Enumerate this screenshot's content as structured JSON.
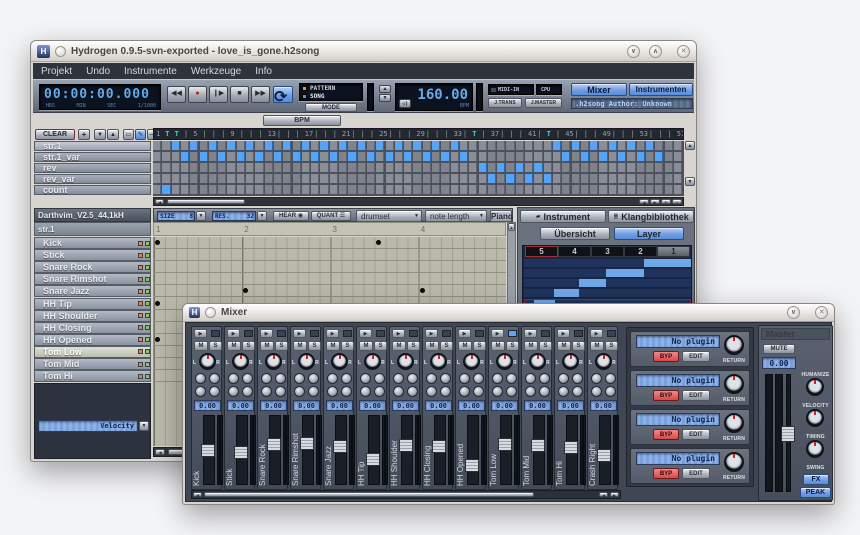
{
  "main_window": {
    "title": "Hydrogen 0.9.5-svn-exported - love_is_gone.h2song",
    "menu": [
      "Projekt",
      "Undo",
      "Instrumente",
      "Werkzeuge",
      "Info"
    ],
    "transport": {
      "time": "00:00:00.000",
      "time_labels": [
        "HRS",
        "MIN",
        "SEC",
        "1/1000"
      ],
      "mode_pattern": "PATTERN",
      "mode_song": "SONG",
      "mode_label": "MODE",
      "bpm_value": "160.00",
      "bpm_label": "BPM",
      "midi_in": "MIDI-IN",
      "cpu": "CPU",
      "jtrans": "J.TRANS",
      "jmaster": "J.MASTER",
      "mixer_btn": "Mixer",
      "rack_btn": "Instrumenten Rack",
      "song_lcd": ".h2song      Author: Unknown"
    },
    "bpm_tab": "BPM",
    "song_editor": {
      "clear_btn": "CLEAR",
      "add_btn": "+",
      "cols": 57,
      "ruler_number_step": 4,
      "t_cells": [
        1,
        2,
        34,
        42
      ],
      "patterns": [
        {
          "name": "str.1",
          "selected": true,
          "cells": [
            2,
            4,
            6,
            8,
            10,
            12,
            14,
            16,
            18,
            20,
            22,
            24,
            26,
            28,
            30,
            32,
            43,
            45,
            47,
            49,
            51,
            53
          ]
        },
        {
          "name": "str.1_var",
          "selected": false,
          "cells": [
            3,
            5,
            7,
            9,
            11,
            13,
            15,
            17,
            19,
            21,
            23,
            25,
            27,
            29,
            31,
            33,
            44,
            46,
            48,
            50,
            52,
            54
          ]
        },
        {
          "name": "rev",
          "selected": false,
          "cells": [
            35,
            37,
            39,
            41
          ]
        },
        {
          "name": "rev_var",
          "selected": false,
          "cells": [
            36,
            38,
            40,
            42
          ]
        },
        {
          "name": "count",
          "selected": false,
          "cells": [
            1
          ]
        }
      ]
    },
    "pattern_editor": {
      "drumkit": "Darthvim_V2.5_44,1kH",
      "pattern_name": "str.1",
      "size_label": "SIZE",
      "size_value": "8",
      "res_label": "RES.",
      "res_value": "32",
      "hear_label": "HEAR",
      "quant_label": "QUANT",
      "drumset_dropdown": "drumset",
      "notelength_dropdown": "note length",
      "piano_btn": "Piano",
      "beats": [
        "1",
        "2",
        "3",
        "4"
      ],
      "velocity_label": "Velocity",
      "instruments": [
        {
          "name": "Kick",
          "selected": false,
          "notes": [
            1,
            3.5
          ]
        },
        {
          "name": "Stick",
          "selected": false,
          "notes": []
        },
        {
          "name": "Snare Rock",
          "selected": false,
          "notes": []
        },
        {
          "name": "Snare Rimshot",
          "selected": false,
          "notes": []
        },
        {
          "name": "Snare Jazz",
          "selected": false,
          "notes": [
            2,
            4
          ]
        },
        {
          "name": "HH Tip",
          "selected": false,
          "notes": [
            1
          ]
        },
        {
          "name": "HH Shoulder",
          "selected": false,
          "notes": []
        },
        {
          "name": "HH Closing",
          "selected": false,
          "notes": []
        },
        {
          "name": "HH Opened",
          "selected": false,
          "notes": [
            1
          ]
        },
        {
          "name": "Tom Low",
          "selected": true,
          "notes": []
        },
        {
          "name": "Tom Mid",
          "selected": false,
          "notes": []
        },
        {
          "name": "Tom Hi",
          "selected": false,
          "notes": []
        }
      ]
    },
    "rack": {
      "tab_instrument": "Instrument",
      "tab_library": "Klangbibliothek",
      "btn_overview": "Übersicht",
      "btn_layer": "Layer",
      "layer_headers": [
        "5",
        "4",
        "3",
        "2",
        "1"
      ],
      "layer_segments": [
        {
          "from": 0.72,
          "to": 1.0,
          "selected": false
        },
        {
          "from": 0.49,
          "to": 0.72,
          "selected": false
        },
        {
          "from": 0.33,
          "to": 0.49,
          "selected": false
        },
        {
          "from": 0.18,
          "to": 0.33,
          "selected": false
        },
        {
          "from": 0.055,
          "to": 0.18,
          "selected": true
        }
      ],
      "empty_rows": 3
    }
  },
  "mixer_window": {
    "title": "Mixer",
    "master": {
      "label": "Master",
      "mute_btn": "MUTE",
      "lcd": "0.00",
      "knob_labels": [
        "HUMANIZE",
        "VELOCITY",
        "TIMING"
      ],
      "swing_label": "SWING",
      "fx_btn": "FX",
      "peak_btn": "PEAK"
    },
    "fx_rack": {
      "rows": [
        {
          "lcd": "No plugin",
          "byp": "BYP",
          "edit": "EDIT",
          "return_label": "RETURN"
        },
        {
          "lcd": "No plugin",
          "byp": "BYP",
          "edit": "EDIT",
          "return_label": "RETURN"
        },
        {
          "lcd": "No plugin",
          "byp": "BYP",
          "edit": "EDIT",
          "return_label": "RETURN"
        },
        {
          "lcd": "No plugin",
          "byp": "BYP",
          "edit": "EDIT",
          "return_label": "RETURN"
        }
      ]
    },
    "channels": [
      {
        "name": "Kick",
        "lcd": "0.00",
        "fader": 0.5,
        "led_on": false
      },
      {
        "name": "Stick",
        "lcd": "0.00",
        "fader": 0.46,
        "led_on": false
      },
      {
        "name": "Snare Rock",
        "lcd": "0.00",
        "fader": 0.6,
        "led_on": false
      },
      {
        "name": "Snare Rimshot",
        "lcd": "0.00",
        "fader": 0.62,
        "led_on": false
      },
      {
        "name": "Snare Jazz",
        "lcd": "0.00",
        "fader": 0.56,
        "led_on": false
      },
      {
        "name": "HH Tip",
        "lcd": "0.00",
        "fader": 0.33,
        "led_on": false
      },
      {
        "name": "HH Shoulder",
        "lcd": "0.00",
        "fader": 0.58,
        "led_on": false
      },
      {
        "name": "HH Closing",
        "lcd": "0.00",
        "fader": 0.56,
        "led_on": false
      },
      {
        "name": "HH Opened",
        "lcd": "0.00",
        "fader": 0.22,
        "led_on": false
      },
      {
        "name": "Tom Low",
        "lcd": "0.00",
        "fader": 0.6,
        "led_on": true
      },
      {
        "name": "Tom Mid",
        "lcd": "0.00",
        "fader": 0.58,
        "led_on": false
      },
      {
        "name": "Tom Hi",
        "lcd": "0.00",
        "fader": 0.55,
        "led_on": false
      },
      {
        "name": "Crash Right",
        "lcd": "0.00",
        "fader": 0.4,
        "led_on": false
      }
    ]
  }
}
